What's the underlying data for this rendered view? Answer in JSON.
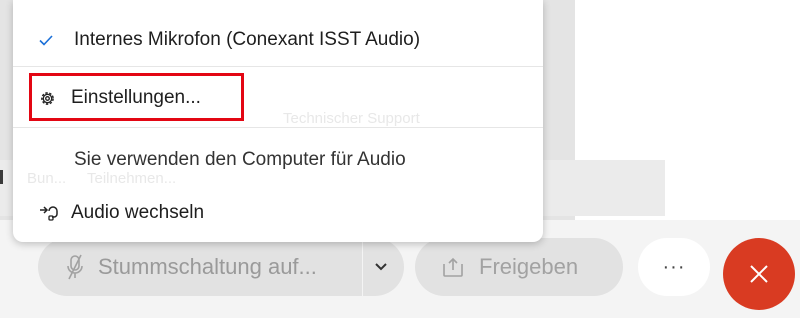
{
  "background": {
    "faded_support_text": "Technischer Support",
    "faded_row_text_1": "Bun...",
    "faded_row_text_2": "Teilnehmen..."
  },
  "menu": {
    "items": [
      {
        "label": "Internes Mikrofon (Conexant ISST Audio)",
        "icon": "checkmark-icon",
        "selected": true
      },
      {
        "label": "Einstellungen...",
        "icon": "gear-icon",
        "highlighted": true
      },
      {
        "label": "Sie verwenden den Computer für Audio"
      },
      {
        "label": "Audio wechseln",
        "icon": "switch-audio-icon"
      }
    ]
  },
  "controls": {
    "mute_label": "Stummschaltung auf...",
    "share_label": "Freigeben",
    "more_label": "···"
  },
  "colors": {
    "end_call": "#d93b22",
    "highlight_border": "#e30613",
    "checkmark": "#1a6fd8"
  }
}
